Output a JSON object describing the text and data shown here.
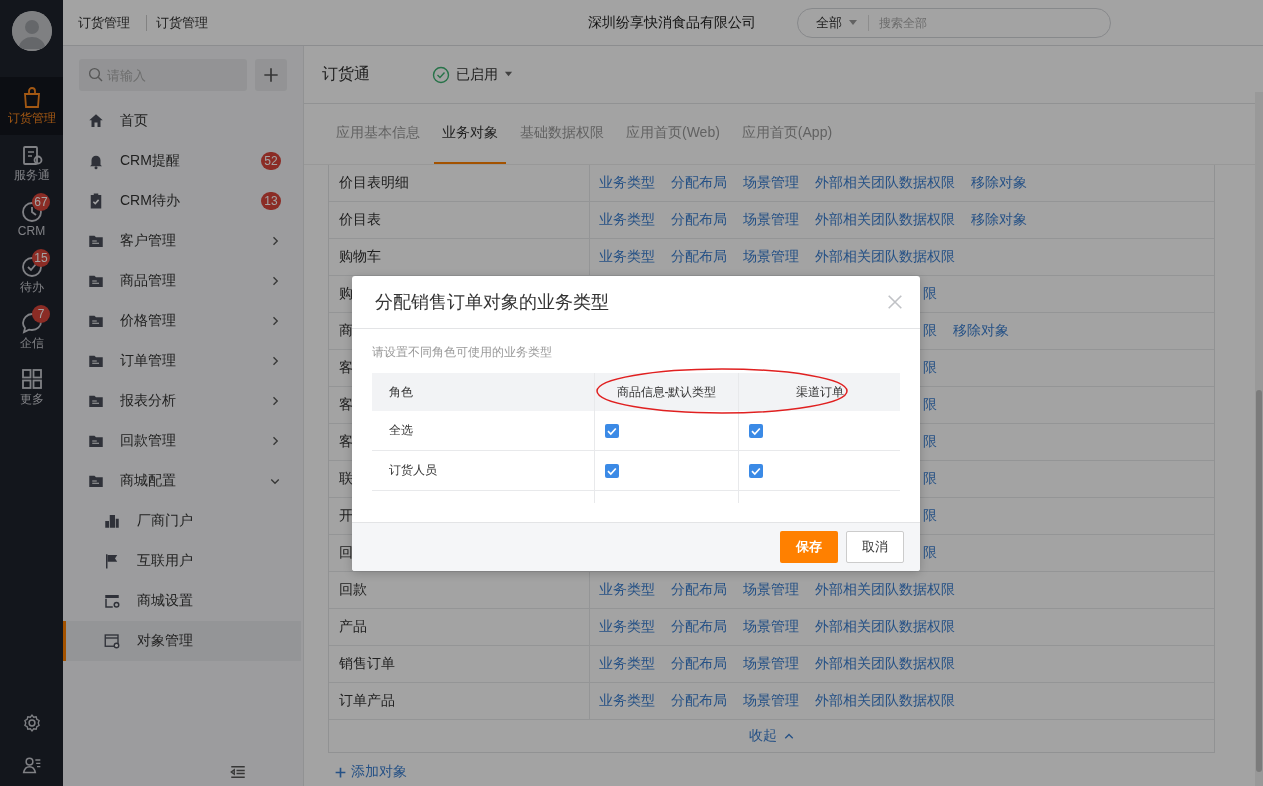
{
  "rail": {
    "items": [
      {
        "kind": "bag",
        "label": "订货管理",
        "selected": true
      },
      {
        "kind": "service",
        "label": "服务通",
        "selected": false
      },
      {
        "kind": "clock",
        "label": "CRM",
        "badge": "67",
        "selected": false
      },
      {
        "kind": "check",
        "label": "待办",
        "badge": "15",
        "selected": false
      },
      {
        "kind": "chat",
        "label": "企信",
        "badge": "7",
        "selected": false
      },
      {
        "kind": "grid",
        "label": "更多",
        "selected": false
      }
    ]
  },
  "header": {
    "breadcrumb": [
      "订货管理",
      "订货管理"
    ],
    "company": "深圳纷享快消食品有限公司",
    "search": {
      "scope": "全部",
      "placeholder": "搜索全部"
    }
  },
  "sidebar": {
    "search": {
      "placeholder": "请输入"
    },
    "items": [
      {
        "kind": "home",
        "label": "首页",
        "selected": false
      },
      {
        "kind": "bell",
        "label": "CRM提醒",
        "badge": "52",
        "selected": false
      },
      {
        "kind": "todo",
        "label": "CRM待办",
        "badge": "13",
        "selected": false
      },
      {
        "kind": "folder",
        "label": "客户管理",
        "expanded": false,
        "selected": false
      },
      {
        "kind": "folder",
        "label": "商品管理",
        "expanded": false,
        "selected": false
      },
      {
        "kind": "folder",
        "label": "价格管理",
        "expanded": false,
        "selected": false
      },
      {
        "kind": "folder",
        "label": "订单管理",
        "expanded": false,
        "selected": false
      },
      {
        "kind": "folder",
        "label": "报表分析",
        "expanded": false,
        "selected": false
      },
      {
        "kind": "folder",
        "label": "回款管理",
        "expanded": false,
        "selected": false
      },
      {
        "kind": "folder",
        "label": "商城配置",
        "expanded": true,
        "selected": false,
        "children": [
          {
            "kind": "building",
            "label": "厂商门户",
            "selected": false
          },
          {
            "kind": "flag",
            "label": "互联用户",
            "selected": false
          },
          {
            "kind": "shop",
            "label": "商城设置",
            "selected": false
          },
          {
            "kind": "window",
            "label": "对象管理",
            "selected": true
          }
        ]
      }
    ]
  },
  "app": {
    "name": "订货通",
    "status": "已启用",
    "tabs": [
      {
        "label": "应用基本信息",
        "selected": false
      },
      {
        "label": "业务对象",
        "selected": true
      },
      {
        "label": "基础数据权限",
        "selected": false
      },
      {
        "label": "应用首页(Web)",
        "selected": false
      },
      {
        "label": "应用首页(App)",
        "selected": false
      }
    ],
    "objects": [
      {
        "kind": "full",
        "label": "价目表明细",
        "links": [
          "业务类型",
          "分配布局",
          "场景管理",
          "外部相关团队数据权限",
          "移除对象"
        ]
      },
      {
        "kind": "full",
        "label": "价目表",
        "links": [
          "业务类型",
          "分配布局",
          "场景管理",
          "外部相关团队数据权限",
          "移除对象"
        ]
      },
      {
        "kind": "full",
        "label": "购物车",
        "links": [
          "业务类型",
          "分配布局",
          "场景管理",
          "外部相关团队数据权限"
        ]
      },
      {
        "kind": "covered",
        "label": "购",
        "links": [
          "限"
        ]
      },
      {
        "kind": "covered",
        "label": "商",
        "links": [
          "限",
          "移除对象"
        ]
      },
      {
        "kind": "covered",
        "label": "客",
        "links": [
          "限"
        ]
      },
      {
        "kind": "covered",
        "label": "客",
        "links": [
          "限"
        ]
      },
      {
        "kind": "covered",
        "label": "客",
        "links": [
          "限"
        ]
      },
      {
        "kind": "covered",
        "label": "联",
        "links": [
          "限"
        ]
      },
      {
        "kind": "covered",
        "label": "开",
        "links": [
          "限"
        ]
      },
      {
        "kind": "covered",
        "label": "回",
        "links": [
          "限"
        ]
      },
      {
        "kind": "full",
        "label": "回款",
        "links": [
          "业务类型",
          "分配布局",
          "场景管理",
          "外部相关团队数据权限"
        ]
      },
      {
        "kind": "full",
        "label": "产品",
        "links": [
          "业务类型",
          "分配布局",
          "场景管理",
          "外部相关团队数据权限"
        ]
      },
      {
        "kind": "full",
        "label": "销售订单",
        "links": [
          "业务类型",
          "分配布局",
          "场景管理",
          "外部相关团队数据权限"
        ]
      },
      {
        "kind": "full",
        "label": "订单产品",
        "links": [
          "业务类型",
          "分配布局",
          "场景管理",
          "外部相关团队数据权限"
        ]
      }
    ],
    "collapse": "收起",
    "add": "添加对象"
  },
  "modal": {
    "title": "分配销售订单对象的业务类型",
    "hint": "请设置不同角色可使用的业务类型",
    "columns": [
      "角色",
      "商品信息-默认类型",
      "渠道订单"
    ],
    "rows": [
      {
        "role": "全选",
        "checks": [
          true,
          true
        ]
      },
      {
        "role": "订货人员",
        "checks": [
          true,
          true
        ]
      }
    ],
    "buttons": [
      {
        "kind": "primary",
        "label": "保存"
      },
      {
        "kind": "default",
        "label": "取消"
      }
    ]
  }
}
